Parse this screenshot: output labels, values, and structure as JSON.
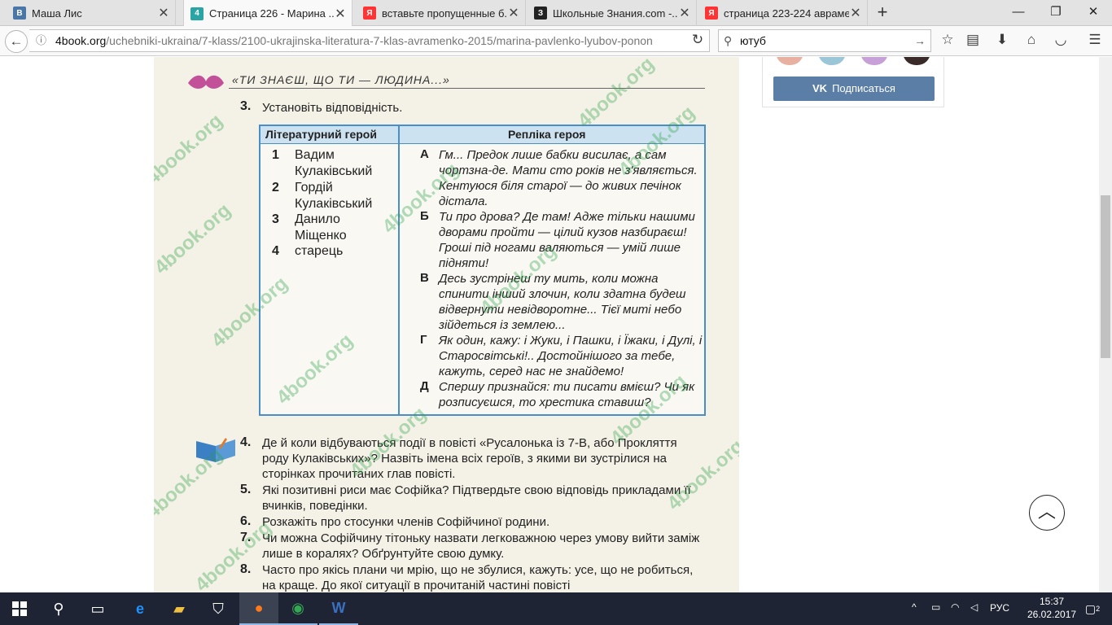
{
  "tabs": [
    {
      "label": "Маша Лис",
      "favicon": "В",
      "color": "#4a76a8",
      "active": false
    },
    {
      "label": "Страница 226 - Марина ...",
      "favicon": "4",
      "color": "#2aa4a4",
      "active": true
    },
    {
      "label": "вставьте пропущенные б...",
      "favicon": "Я",
      "color": "#ff3333",
      "active": false
    },
    {
      "label": "Школьные Знания.com -...",
      "favicon": "З",
      "color": "#222",
      "active": false
    },
    {
      "label": "страница 223-224 авраме...",
      "favicon": "Я",
      "color": "#ff3333",
      "active": false
    }
  ],
  "window": {
    "minimize": "—",
    "restore": "❐",
    "close": "✕",
    "newtab": "+"
  },
  "navbar": {
    "url_host": "4book.org",
    "url_path": "/uchebniki-ukraina/7-klass/2100-ukrajinska-literatura-7-klas-avramenko-2015/marina-pavlenko-lyubov-ponon",
    "search_value": "ютуб"
  },
  "book": {
    "header": "«ТИ ЗНАЄШ, ЩО ТИ — ЛЮДИНА...»",
    "q3": "Установіть відповідність.",
    "table": {
      "col1": "Літературний герой",
      "col2": "Репліка героя",
      "heroes": [
        {
          "n": "1",
          "name": "Вадим Кулаківський"
        },
        {
          "n": "2",
          "name": "Гордій Кулаківський"
        },
        {
          "n": "3",
          "name": "Данило Міщенко"
        },
        {
          "n": "4",
          "name": "старець"
        }
      ],
      "replies": [
        {
          "l": "А",
          "t": "Гм... Предок лише бабки висилає, а сам чортзна-де. Мати сто років не з'являється. Кентуюся біля старої — до живих печінок дістала."
        },
        {
          "l": "Б",
          "t": "Ти про дрова? Де там! Адже тільки нашими дворами пройти — цілий кузов назбираєш! Гроші під ногами валяються — умій лише підняти!"
        },
        {
          "l": "В",
          "t": "Десь зустрінеш ту мить, коли можна спинити інший злочин, коли здатна будеш відвернути невідворотне... Тієї миті небо зійдеться із землею..."
        },
        {
          "l": "Г",
          "t": "Як один, кажу: і Жуки, і Пашки, і Їжаки, і Дулі, і Старосвітські!.. Достойнішого за тебе, кажуть, серед нас не знайдемо!"
        },
        {
          "l": "Д",
          "t": "Спершу признайся: ти писати вмієш? Чи як розписуєшся, то хрестика ставиш?"
        }
      ]
    },
    "questions": [
      {
        "n": "4.",
        "t": "Де й коли відбуваються події в повісті «Русалонька із 7-В, або Прокляття роду Кулаківських»? Назвіть імена всіх героїв, з якими ви зустрілися на сторінках прочитаних глав повісті."
      },
      {
        "n": "5.",
        "t": "Які позитивні риси має Софійка? Підтвердьте свою відповідь прикладами її вчинків, поведінки."
      },
      {
        "n": "6.",
        "t": "Розкажіть про стосунки членів Софійчиної родини."
      },
      {
        "n": "7.",
        "t": "Чи можна Софійчину тітоньку назвати легковажною через умову вийти заміж лише в коралях? Обґрунтуйте свою думку."
      },
      {
        "n": "8.",
        "t": "Часто про якісь плани чи мрію, що не збулися, кажуть: усе, що не робиться, на краще. До якої ситуації в прочитаній частині повісті"
      }
    ],
    "watermark": "4book.org"
  },
  "sidebar": {
    "subscribe_label": "Подписаться",
    "vk_logo": "VK"
  },
  "taskbar": {
    "lang": "РУС",
    "time": "15:37",
    "date": "26.02.2017",
    "notif_count": "2"
  }
}
